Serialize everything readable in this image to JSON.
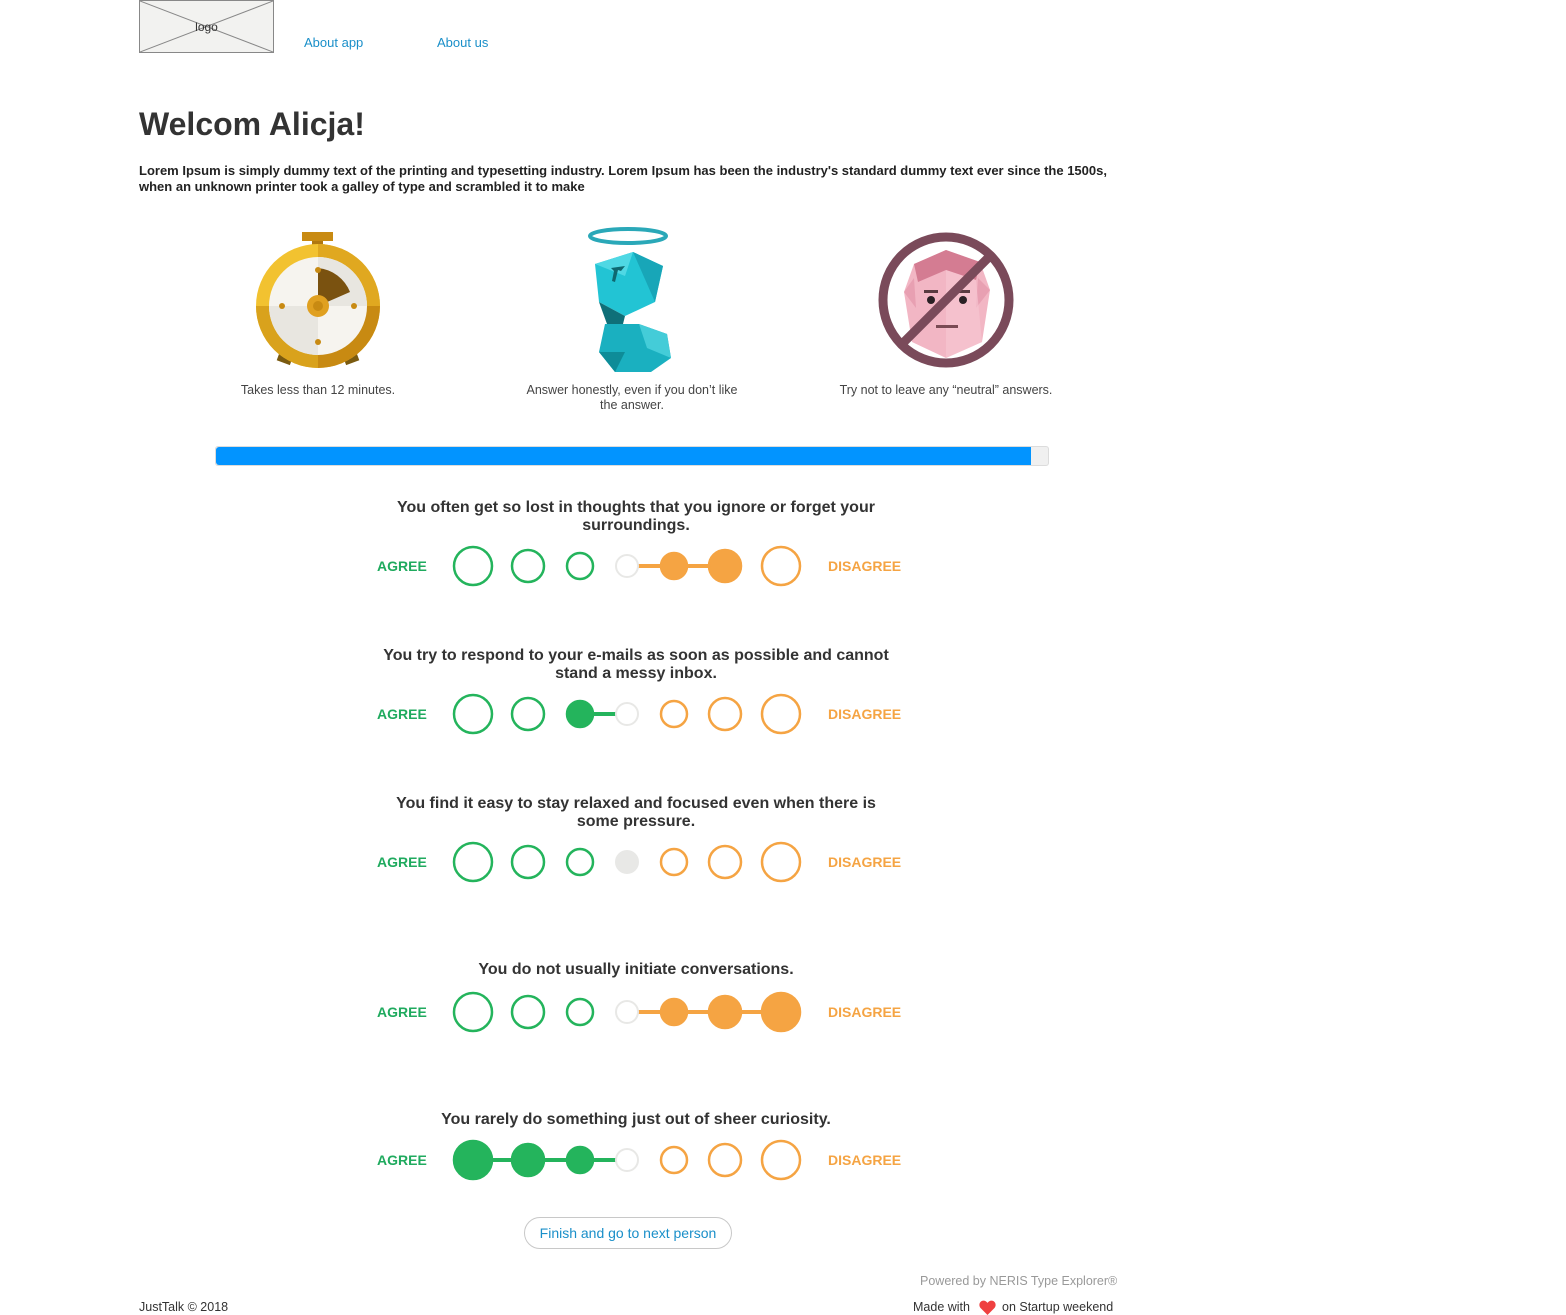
{
  "header": {
    "logo_text": "logo",
    "nav": [
      {
        "label": "About app"
      },
      {
        "label": "About us"
      }
    ]
  },
  "welcome": {
    "title": "Welcom Alicja!",
    "intro": "Lorem Ipsum is simply dummy text of the printing and typesetting industry. Lorem Ipsum has been the industry's standard dummy text ever since the 1500s, when an unknown printer took a galley of type and scrambled it to make"
  },
  "features": [
    {
      "icon": "stopwatch-icon",
      "caption": "Takes less than 12 minutes."
    },
    {
      "icon": "angel-figure-icon",
      "caption": "Answer honestly, even if you don’t like the answer."
    },
    {
      "icon": "no-neutral-face-icon",
      "caption": "Try not to leave any “neutral” answers."
    }
  ],
  "progress": {
    "value": 0.98
  },
  "scale": {
    "agree_label": "AGREE",
    "disagree_label": "DISAGREE",
    "points": 7
  },
  "questions": [
    {
      "text": "You often get so lost in thoughts that you ignore or forget your surroundings.",
      "selected": 6
    },
    {
      "text": "You try to respond to your e-mails as soon as possible and cannot stand a messy inbox.",
      "selected": 3
    },
    {
      "text": "You find it easy to stay relaxed and focused even when there is some pressure.",
      "selected": 4
    },
    {
      "text": "You do not usually initiate conversations.",
      "selected": 7
    },
    {
      "text": "You rarely do something just out of sheer curiosity.",
      "selected": 1
    }
  ],
  "finish_button": {
    "label": "Finish and go to next person"
  },
  "footer": {
    "copyright": "JustTalk © 2018",
    "powered": "Powered by NERIS Type Explorer®",
    "made_with_prefix": "Made with",
    "made_with_suffix": "on Startup weekend",
    "heart_icon": "heart-icon"
  },
  "colors": {
    "agree": "#1faa5e",
    "agree_fill": "#24b45c",
    "disagree": "#f5a443",
    "neutral": "#e8e8e6",
    "link": "#1a8fc9",
    "progress": "#0294ff",
    "heart": "#ef4040"
  }
}
